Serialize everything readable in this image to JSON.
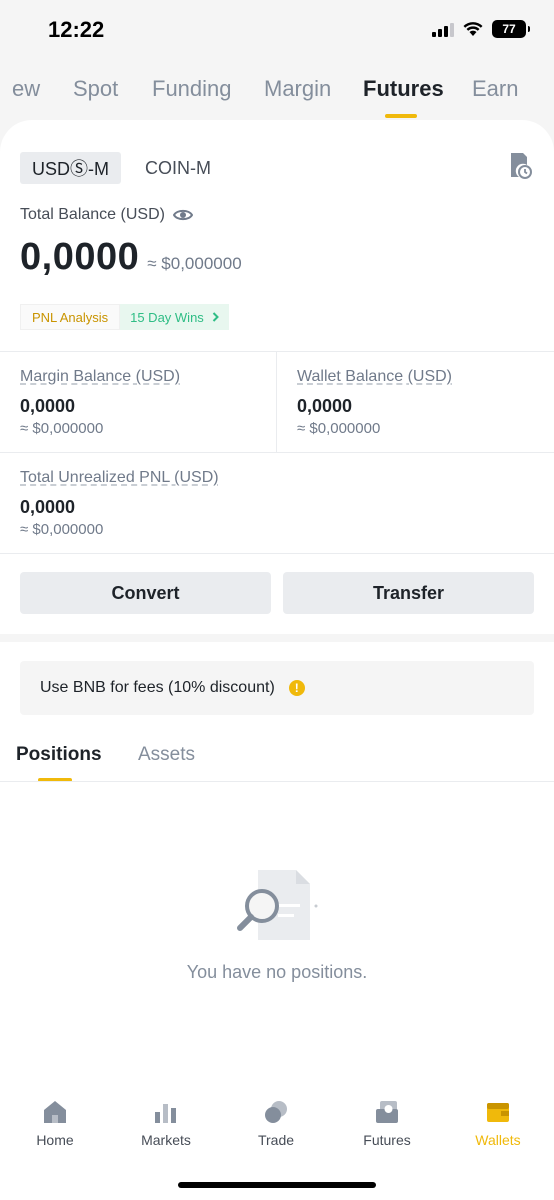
{
  "status": {
    "time": "12:22",
    "battery": "77"
  },
  "top_tabs": [
    "ew",
    "Spot",
    "Funding",
    "Margin",
    "Futures",
    "Earn"
  ],
  "top_tab_active": "Futures",
  "segment": {
    "active": "USDⓈ-M",
    "inactive": "COIN-M"
  },
  "balance": {
    "label": "Total Balance (USD)",
    "value": "0,0000",
    "approx": "≈ $0,000000"
  },
  "pnl": {
    "analysis": "PNL Analysis",
    "wins": "15 Day Wins"
  },
  "metrics": {
    "margin": {
      "label": "Margin Balance (USD)",
      "value": "0,0000",
      "approx": "≈ $0,000000"
    },
    "wallet": {
      "label": "Wallet Balance (USD)",
      "value": "0,0000",
      "approx": "≈ $0,000000"
    },
    "unrealized": {
      "label": "Total Unrealized PNL (USD)",
      "value": "0,0000",
      "approx": "≈ $0,000000"
    }
  },
  "actions": {
    "convert": "Convert",
    "transfer": "Transfer"
  },
  "bnb_notice": "Use BNB for fees (10% discount)",
  "sub_tabs": {
    "positions": "Positions",
    "assets": "Assets"
  },
  "empty_state": "You have no positions.",
  "bottom_nav": {
    "home": "Home",
    "markets": "Markets",
    "trade": "Trade",
    "futures": "Futures",
    "wallets": "Wallets"
  },
  "colors": {
    "accent": "#f0b90b",
    "positive": "#2ebd85",
    "text": "#1e2329",
    "muted": "#848e9c"
  }
}
